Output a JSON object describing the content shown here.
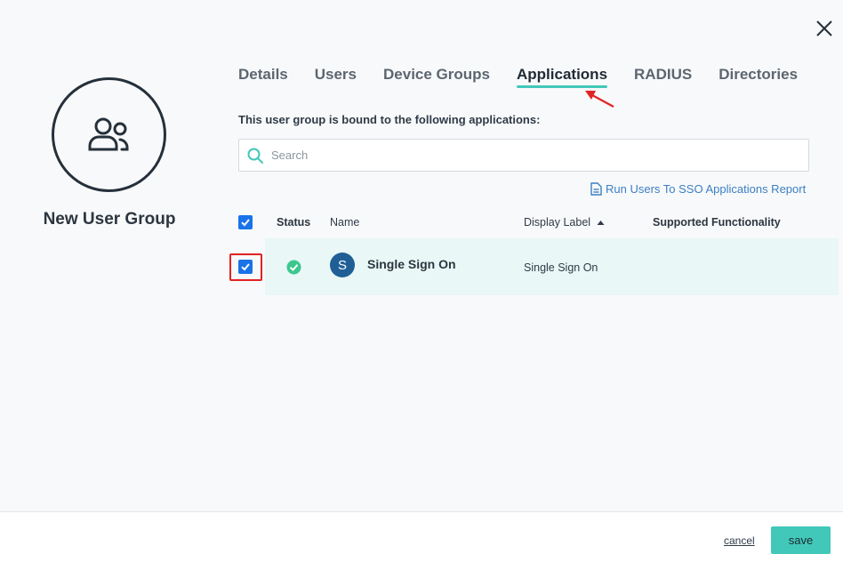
{
  "dialog": {
    "group_name": "New User Group"
  },
  "tabs": [
    {
      "label": "Details",
      "active": false
    },
    {
      "label": "Users",
      "active": false
    },
    {
      "label": "Device Groups",
      "active": false
    },
    {
      "label": "Applications",
      "active": true
    },
    {
      "label": "RADIUS",
      "active": false
    },
    {
      "label": "Directories",
      "active": false
    }
  ],
  "applications_panel": {
    "intro": "This user group is bound to the following applications:",
    "search_placeholder": "Search",
    "search_value": "",
    "report_link": "Run Users To SSO Applications Report",
    "columns": {
      "status": "Status",
      "name": "Name",
      "display_label": "Display Label",
      "supported_functionality": "Supported Functionality"
    },
    "rows": [
      {
        "checked": true,
        "status": "active",
        "avatar_letter": "S",
        "name": "Single Sign On",
        "display_label": "Single Sign On",
        "supported_functionality": ""
      }
    ]
  },
  "footer": {
    "cancel_label": "cancel",
    "save_label": "save"
  },
  "colors": {
    "accent": "#41c8b9",
    "link": "#3b7fc4",
    "checkbox": "#1a73e8",
    "row_selected_bg": "#e9f7f6",
    "status_ok": "#3cc78f",
    "annotation_red": "#e02424"
  },
  "icons": {
    "close": "close-icon",
    "user_group": "users-group-icon",
    "search": "search-icon",
    "report": "document-icon",
    "sort": "caret-up-icon",
    "status": "check-circle-icon"
  }
}
